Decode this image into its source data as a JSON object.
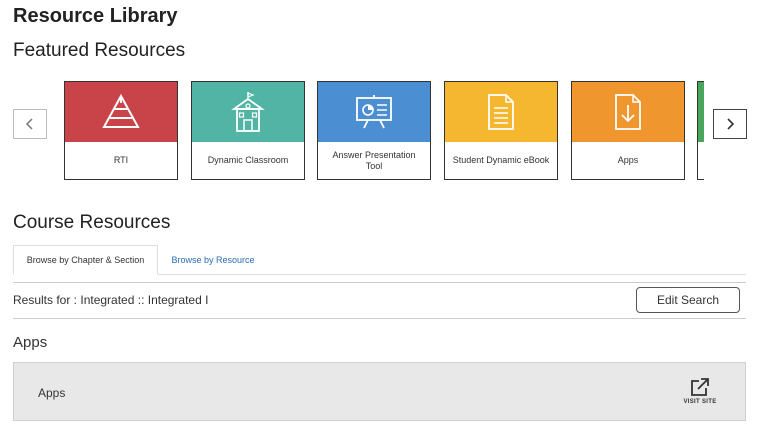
{
  "page": {
    "title": "Resource Library"
  },
  "featured": {
    "heading": "Featured Resources",
    "cards": [
      {
        "label": "RTI",
        "color": "#c94448",
        "icon": "pyramid-icon"
      },
      {
        "label": "Dynamic Classroom",
        "color": "#52b4a4",
        "icon": "schoolhouse-icon"
      },
      {
        "label": "Answer Presentation Tool",
        "color": "#4b8ed1",
        "icon": "presentation-board-icon"
      },
      {
        "label": "Student Dynamic eBook",
        "color": "#f6b730",
        "icon": "document-icon"
      },
      {
        "label": "Apps",
        "color": "#f0962e",
        "icon": "download-icon"
      },
      {
        "label": "",
        "color": "#4aa65c",
        "icon": ""
      }
    ]
  },
  "course": {
    "heading": "Course Resources",
    "tabs": [
      {
        "label": "Browse by Chapter & Section",
        "active": true
      },
      {
        "label": "Browse by Resource",
        "active": false
      }
    ],
    "results_text": "Results for : Integrated :: Integrated I",
    "edit_search_label": "Edit Search",
    "section_heading": "Apps",
    "items": [
      {
        "name": "Apps",
        "action_label": "VISIT SITE",
        "action_icon": "external-link-icon"
      }
    ]
  }
}
